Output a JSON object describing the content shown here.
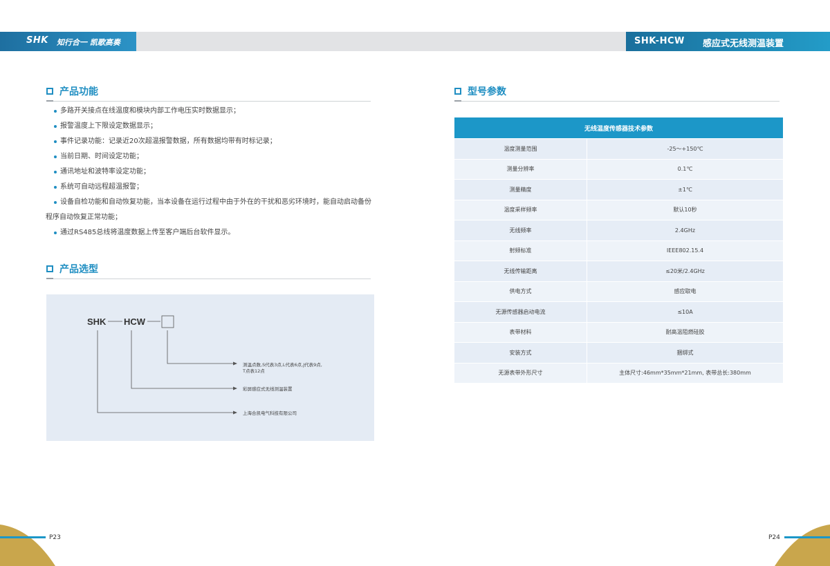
{
  "header": {
    "brand": "SHK",
    "slogan": "知行合一 凯歌高奏",
    "model": "SHK-HCW",
    "product": "感应式无线测温装置"
  },
  "left": {
    "functions": {
      "title": "产品功能",
      "items": [
        "多路开关接点在线温度和模块内部工作电压实时数据显示；",
        "报警温度上下限设定数据显示；",
        "事件记录功能：记录近20次超温报警数据，所有数据均带有时标记录；",
        "当前日期、时间设定功能；",
        "通讯地址和波特率设定功能；",
        "系统可自动远程超温报警；",
        "设备自检功能和自动恢复功能，当本设备在运行过程中由于外在的干扰和恶劣环境时，能自动启动备份"
      ],
      "item7_cont": "程序自动恢复正常功能；",
      "item8": "通过RS485总线将温度数据上传至客户端后台软件显示。"
    },
    "selection": {
      "title": "产品选型",
      "code_shk": "SHK",
      "code_hcw": "HCW",
      "desc1_line1": "测温点数,S代表3点,L代表6点,J代表9点,",
      "desc1_line2": "T点表12点",
      "desc2": "彩屏感应式无线测温装置",
      "desc3": "上海合凯电气科技有限公司"
    },
    "page": "P23"
  },
  "right": {
    "params": {
      "title": "型号参数",
      "table_title": "无线温度传感器技术参数",
      "rows": [
        [
          "温度测量范围",
          "-25～+150℃"
        ],
        [
          "测量分辨率",
          "0.1℃"
        ],
        [
          "测量精度",
          "±1℃"
        ],
        [
          "温度采样频率",
          "默认10秒"
        ],
        [
          "无线频率",
          "2.4GHz"
        ],
        [
          "射频标准",
          "IEEE802.15.4"
        ],
        [
          "无线传输距离",
          "≤20米/2.4GHz"
        ],
        [
          "供电方式",
          "感应取电"
        ],
        [
          "无源传感器启动电流",
          "≤10A"
        ],
        [
          "表带材料",
          "耐高温阻燃硅胶"
        ],
        [
          "安装方式",
          "捆绑式"
        ],
        [
          "无源表带外形尺寸",
          "主体尺寸:46mm*35mm*21mm, 表带总长:380mm"
        ]
      ]
    },
    "page": "P24"
  },
  "colors": {
    "accent": "#1f8ec2",
    "table_header": "#1c97c8",
    "gold": "#c9a64c"
  }
}
